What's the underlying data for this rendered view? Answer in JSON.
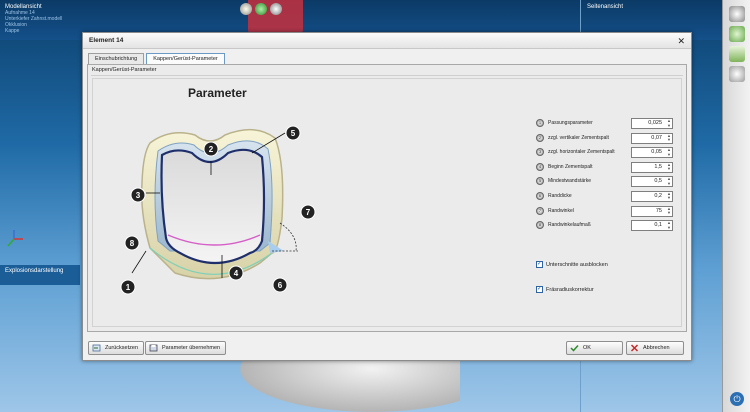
{
  "bg": {
    "left_panel_title": "Modellansicht",
    "left_panel_lines": [
      "Aufnahme 14",
      "Unterkiefer Zahnst.modell",
      "Okklusion",
      "Kappe"
    ],
    "right_panel_title": "Seitenansicht",
    "explosion_label": "Explosionsdarstellung"
  },
  "dialog": {
    "title": "Element 14",
    "close": "✕",
    "tabs": [
      {
        "label": "Einschubrichtung"
      },
      {
        "label": "Kappen/Gerüst-Parameter"
      }
    ],
    "section_title": "Kappen/Gerüst-Parameter",
    "heading": "Parameter",
    "params": [
      {
        "num": "1",
        "label": "Passungsparameter",
        "value": "0,025"
      },
      {
        "num": "2",
        "label": "zzgl. vertikaler Zementspalt",
        "value": "0,07"
      },
      {
        "num": "3",
        "label": "zzgl. horizontaler Zementspalt",
        "value": "0,05"
      },
      {
        "num": "4",
        "label": "Beginn Zementspalt",
        "value": "1,5"
      },
      {
        "num": "5",
        "label": "Mindestwandstärke",
        "value": "0,5"
      },
      {
        "num": "6",
        "label": "Randdicke",
        "value": "0,2"
      },
      {
        "num": "7",
        "label": "Randwinkel",
        "value": "75"
      },
      {
        "num": "8",
        "label": "Randwinkelaufmaß",
        "value": "0,1"
      }
    ],
    "checkboxes": [
      {
        "label": "Unterschnitte ausblocken",
        "checked": true
      },
      {
        "label": "Fräsradiuskorrektur",
        "checked": true
      }
    ],
    "diagram_markers": [
      "1",
      "2",
      "3",
      "4",
      "5",
      "6",
      "7",
      "8"
    ],
    "buttons": {
      "reset": "Zurücksetzen",
      "apply": "Parameter übernehmen",
      "ok": "OK",
      "cancel": "Abbrechen"
    }
  }
}
